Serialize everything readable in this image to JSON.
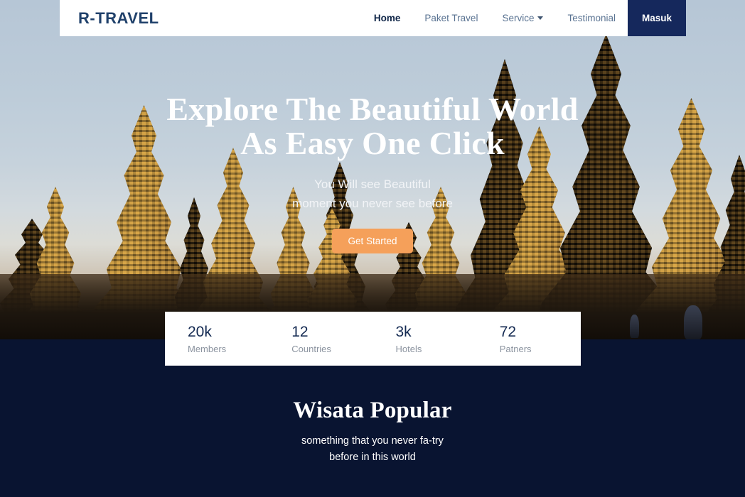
{
  "brand": {
    "name": "R-TRAVEL"
  },
  "nav": {
    "items": [
      {
        "label": "Home",
        "active": true,
        "dropdown": false
      },
      {
        "label": "Paket Travel",
        "active": false,
        "dropdown": false
      },
      {
        "label": "Service",
        "active": false,
        "dropdown": true
      },
      {
        "label": "Testimonial",
        "active": false,
        "dropdown": false
      }
    ],
    "login_label": "Masuk"
  },
  "hero": {
    "title_line1": "Explore The Beautiful World",
    "title_line2": "As Easy One Click",
    "subtitle_line1": "You Will see Beautiful",
    "subtitle_line2": "moment you never see before",
    "cta_label": "Get Started",
    "image_alt": "Prambanan temple complex at sunset"
  },
  "stats": [
    {
      "value": "20k",
      "label": "Members"
    },
    {
      "value": "12",
      "label": "Countries"
    },
    {
      "value": "3k",
      "label": "Hotels"
    },
    {
      "value": "72",
      "label": "Patners"
    }
  ],
  "popular": {
    "title": "Wisata Popular",
    "subtitle_line1": "something that you never fa-try",
    "subtitle_line2": "before in this world"
  },
  "colors": {
    "navy": "#091431",
    "brand_navy": "#20416b",
    "login_navy": "#15285c",
    "accent_orange": "#f5a05a",
    "sky": "#b9c9d8",
    "muted_text": "#8b939f"
  }
}
